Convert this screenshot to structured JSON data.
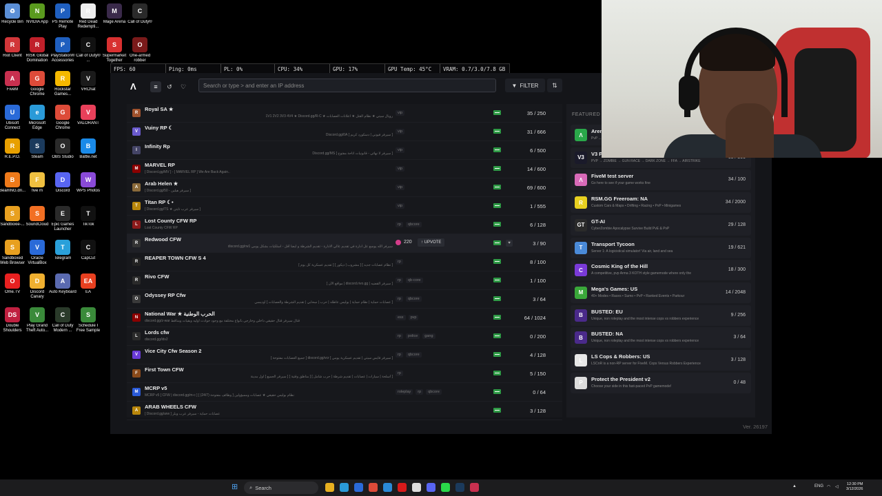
{
  "desktop_icons": [
    {
      "label": "Recycle Bin",
      "color": "#5b8fd6",
      "glyph": "♻"
    },
    {
      "label": "NVIDIA App",
      "color": "#5a9a1e",
      "glyph": "N"
    },
    {
      "label": "PS Remote Play",
      "color": "#1f5fbf",
      "glyph": "P"
    },
    {
      "label": "Red Dead Redempti...",
      "color": "#eeeeee",
      "glyph": "R"
    },
    {
      "label": "Mage Arena",
      "color": "#3a2a4a",
      "glyph": "M"
    },
    {
      "label": "Call of Duty®",
      "color": "#2a2a2a",
      "glyph": "C"
    },
    {
      "label": "Riot Client",
      "color": "#d13639",
      "glyph": "R"
    },
    {
      "label": "RISK Global Domination",
      "color": "#c0202a",
      "glyph": "R"
    },
    {
      "label": "PlayStation® Accessories",
      "color": "#1f5fbf",
      "glyph": "P"
    },
    {
      "label": "Call of Duty® ...",
      "color": "#111111",
      "glyph": "C"
    },
    {
      "label": "Supermarket Together",
      "color": "#d83030",
      "glyph": "S"
    },
    {
      "label": "One-armed robber",
      "color": "#7a1a1a",
      "glyph": "O"
    },
    {
      "label": "FiveM",
      "color": "#c8304f",
      "glyph": "A"
    },
    {
      "label": "Google Chrome",
      "color": "#dd4b39",
      "glyph": "G"
    },
    {
      "label": "Rockstar Games...",
      "color": "#f5b800",
      "glyph": "R"
    },
    {
      "label": "VRChat",
      "color": "#1a1a1a",
      "glyph": "V"
    },
    {
      "label": "Ubisoft Connect",
      "color": "#2a6ad8",
      "glyph": "U"
    },
    {
      "label": "Microsoft Edge",
      "color": "#2a9ad8",
      "glyph": "e"
    },
    {
      "label": "Google Chrome",
      "color": "#dd4b39",
      "glyph": "G"
    },
    {
      "label": "VALORANT",
      "color": "#e8405a",
      "glyph": "V"
    },
    {
      "label": "R.E.P.O.",
      "color": "#e8a000",
      "glyph": "R"
    },
    {
      "label": "Steam",
      "color": "#1b3a5c",
      "glyph": "S"
    },
    {
      "label": "OBS Studio",
      "color": "#2a2a2a",
      "glyph": "O"
    },
    {
      "label": "Battle.net",
      "color": "#1a8ae8",
      "glyph": "B"
    },
    {
      "label": "BeamNG.dri...",
      "color": "#ef7a1a",
      "glyph": "B"
    },
    {
      "label": "five m",
      "color": "#f0c040",
      "glyph": "F"
    },
    {
      "label": "Discord",
      "color": "#5865f2",
      "glyph": "D"
    },
    {
      "label": "WPS Photos",
      "color": "#8a4ad8",
      "glyph": "W"
    },
    {
      "label": "Sandboxie-...",
      "color": "#e8a020",
      "glyph": "S"
    },
    {
      "label": "SoundCloud",
      "color": "#f26f23",
      "glyph": "S"
    },
    {
      "label": "Epic Games Launcher",
      "color": "#2a2a2a",
      "glyph": "E"
    },
    {
      "label": "TikTok",
      "color": "#111111",
      "glyph": "T"
    },
    {
      "label": "Sandboxed Web Browser",
      "color": "#e8a020",
      "glyph": "S"
    },
    {
      "label": "Oracle VirtualBox",
      "color": "#2a6ad8",
      "glyph": "V"
    },
    {
      "label": "Telegram",
      "color": "#2aa0da",
      "glyph": "T"
    },
    {
      "label": "CapCut",
      "color": "#111111",
      "glyph": "C"
    },
    {
      "label": "Ome.TV",
      "color": "#e82020",
      "glyph": "O"
    },
    {
      "label": "Discord Canary",
      "color": "#f0b030",
      "glyph": "D"
    },
    {
      "label": "Auto Keyboard",
      "color": "#5a6ab0",
      "glyph": "A"
    },
    {
      "label": "EA",
      "color": "#e84020",
      "glyph": "EA"
    },
    {
      "label": "Double Shoulders",
      "color": "#c02040",
      "glyph": "DS"
    },
    {
      "label": "Play Grand Theft Auto...",
      "color": "#3a8a3a",
      "glyph": "V"
    },
    {
      "label": "Call of Duty Modern ...",
      "color": "#2a3a2a",
      "glyph": "C"
    },
    {
      "label": "Schedule I Free Sample",
      "color": "#3a8a3a",
      "glyph": "S"
    }
  ],
  "stats": {
    "fps": "FPS: 60",
    "ping": "Ping: 0ms",
    "pl": "PL: 0%",
    "cpu": "CPU: 34%",
    "gpu": "GPU: 17%",
    "gpu_temp": "GPU Temp: 45°C",
    "vram": "VRAM: 0.7/3.0/7.8 GB"
  },
  "app": {
    "logo": "Λ",
    "search_placeholder": "Search or type > and enter an IP address",
    "filter_label": "FILTER",
    "featured_label": "FEATURED S",
    "version": "Ver. 26197"
  },
  "servers": [
    {
      "name": "Royal SA ★",
      "desc": "رويال سيتي ★ نظام القتل ★ اعلانات العصابات ★ 1V1 2V2 3V3 4V4 ★ Discord.gg/R-C",
      "tags": [
        "vip"
      ],
      "players": "35 / 250",
      "color": "#a0522d",
      "glyph": "R"
    },
    {
      "name": "Vuiny RP ☾",
      "desc": "[ سيرفر فيوني | دسكورد كريم ] Discord.gg/0A",
      "tags": [
        "vip"
      ],
      "players": "31 / 666",
      "color": "#6a5acd",
      "glyph": "V"
    },
    {
      "name": "Infinity Rp",
      "desc": "[ سيرفر لا نهائي - قانونيات اتاحة مفتوح ] Discord.gg/MS",
      "tags": [
        "vip"
      ],
      "players": "6 / 500",
      "color": "#444466",
      "glyph": "I"
    },
    {
      "name": "MARVEL RP",
      "desc": "[ Discord.gg/MV ] - [ MARVEL RP ] We Are Back Again..",
      "tags": [
        "vip"
      ],
      "players": "14 / 600",
      "color": "#8b0000",
      "glyph": "M"
    },
    {
      "name": "Arab Helen ★",
      "desc": "[ Discord.gg/50 - سيرفر هيلين ]",
      "tags": [
        "vip"
      ],
      "players": "69 / 600",
      "color": "#8a6a3a",
      "glyph": "A"
    },
    {
      "name": "Titan RP ☾•",
      "desc": "[ Discord.gg/TS ★ سيرفر عرب تايتن ]",
      "tags": [
        "vip"
      ],
      "players": "1 / 555",
      "color": "#b8860b",
      "glyph": "T"
    },
    {
      "name": "Lost County CFW RP",
      "desc": "Lost County CFW RP",
      "tags": [
        "rp",
        "qbcore"
      ],
      "players": "6 / 128",
      "color": "#8b1a1a",
      "glyph": "L"
    },
    {
      "name": "Redwood CFW",
      "desc": "سيرفر الله يوسع عل ادارة في تقديم عالي الادارة - تقديم الشرطة و ايضا أقل - اسلكيات بشكل يومي discord.gg/rw1",
      "tags": [],
      "players": "3 / 90",
      "color": "#333333",
      "glyph": "R",
      "upvotes": "220",
      "upvote_label": "UPVOTE"
    },
    {
      "name": "REAPER TOWN CFW S 4",
      "desc": "[ نظام عصابات جديد ] [ مشروب | ديكور ] [ تقديم عسكرية كل يوم ]",
      "tags": [
        "rp"
      ],
      "players": "8 / 100",
      "color": "#222222",
      "glyph": "R"
    },
    {
      "name": "Rivo CFW",
      "desc": "[ سيرفر القضيه | discord.rivo.gg | مواقع الآن ]",
      "tags": [
        "rp",
        "qb-core"
      ],
      "players": "1 / 100",
      "color": "#2a2a2a",
      "glyph": "R"
    },
    {
      "name": "Odyssey RP Cfw",
      "desc": "[ عصابات حماية | نظام حماية | بوليس عاطله | حرب | سحابي | تقديم الشرطة والعصابات ] أوديسي",
      "tags": [
        "rp",
        "qbcore"
      ],
      "players": "3 / 64",
      "color": "#3a3a3a",
      "glyph": "O"
    },
    {
      "name": "National War ★ الحرب الوطنية",
      "desc": "discord.gg/z-war قتال سيرفر قتال حقيقي داخلي وخارجي بأنواع مختلفة مع وجود حوادث اوليه وبقيات ومناقط",
      "tags": [
        "esx",
        "pvp"
      ],
      "players": "64 / 1024",
      "color": "#8b0000",
      "glyph": "N"
    },
    {
      "name": "Lords cfw",
      "desc": "discord.gg/ldv2",
      "tags": [
        "rp",
        "police",
        "gang"
      ],
      "players": "0 / 200",
      "color": "#2a2a2a",
      "glyph": "L"
    },
    {
      "name": "Vice City Cfw Season 2",
      "desc": "[ سيرفر فايس سيتي | تقديم عسكرية يومي ] discord.gg/vcr [ جميع العصابات مفتوحة ]",
      "tags": [
        "rp",
        "qbcore"
      ],
      "players": "4 / 128",
      "color": "#6a3ad8",
      "glyph": "V"
    },
    {
      "name": "First Town CFW",
      "desc": "[ أسلحة | سيارات | عصابات | تقديم شرطة | حرب شامل ] [ مناطق وقتية ] [ سيرفر الجميع ] اول مدينة",
      "tags": [
        "rp"
      ],
      "players": "5 / 150",
      "color": "#8a4a1a",
      "glyph": "F"
    },
    {
      "name": "MCRP v5",
      "desc": "MCRP v5 [ CFW | discord.gg/m-c ] [ وظائف مفتوحة (24/7) ] نظام بوليس حقيقي ★ عصابات ومسؤولين",
      "tags": [
        "roleplay",
        "rp",
        "qbcore"
      ],
      "players": "0 / 64",
      "color": "#2a5ad8",
      "glyph": "M"
    },
    {
      "name": "ARAB WHEELS CFW",
      "desc": "[ Discord.gg/arw ] عصابات حماية - سيرفر عرب ويلز",
      "tags": [],
      "players": "3 / 128",
      "color": "#b8860b",
      "glyph": "A"
    }
  ],
  "featured": [
    {
      "name": "Arena",
      "desc": "PvP ...",
      "players": "",
      "color": "#2aa84a",
      "glyph": "Λ"
    },
    {
      "name": "V3 P...",
      "desc": "PVP → ZOMBIE → GUN RACE → DARK ZONE → FFA → AIRSTRIKE",
      "players": "68 / 300",
      "color": "#1a1a2a",
      "glyph": "V3"
    },
    {
      "name": "FiveM test server",
      "desc": "Go here to see if your game works fine",
      "players": "34 / 100",
      "color": "#d86ab8",
      "glyph": "Λ"
    },
    {
      "name": "RSM.GG Freeroam: NA",
      "desc": "Custom Cars & Maps • Drifting • Racing • PvP • Minigames",
      "players": "34 / 2000",
      "color": "#e8d020",
      "glyph": "R"
    },
    {
      "name": "GT-AI",
      "desc": "CyberZombie Apocalypse Survive Build PvE & PvP",
      "players": "29 / 128",
      "color": "#2a2a2a",
      "glyph": "GT"
    },
    {
      "name": "Transport Tycoon",
      "desc": "Server 1: A logicistical simulator! Via air, land and sea",
      "players": "19 / 621",
      "color": "#4a8ad8",
      "glyph": "T"
    },
    {
      "name": "Cosmic King of the Hill",
      "desc": "A competitive, pvp Arma 3 KOTH style gamemode where only the",
      "players": "18 / 300",
      "color": "#7a3ad8",
      "glyph": "C"
    },
    {
      "name": "Mega's Games: US",
      "desc": "40+ Modes • Races • Sumo • PvP • Ranked Events • Parkour",
      "players": "14 / 2048",
      "color": "#3aa83a",
      "glyph": "M"
    },
    {
      "name": "BUSTED: EU",
      "desc": "Unique, non roleplay and the most intense cops vs robbers experience",
      "players": "9 / 256",
      "color": "#4a2a8a",
      "glyph": "B"
    },
    {
      "name": "BUSTED: NA",
      "desc": "Unique, non roleplay and the most intense cops vs robbers experience",
      "players": "3 / 64",
      "color": "#4a2a8a",
      "glyph": "B"
    },
    {
      "name": "LS Cops & Robbers: US",
      "desc": "LSCnR is a non-RP server for FiveM. Cops Versus Robbers Experience",
      "players": "3 / 128",
      "color": "#e8e8e8",
      "glyph": "L"
    },
    {
      "name": "Protect the President v2",
      "desc": "Choose your side in this fast-paced PvP gamemode!",
      "players": "0 / 48",
      "color": "#dddddd",
      "glyph": "P"
    }
  ],
  "taskbar": {
    "search_label": "Search",
    "lang": "ENG",
    "time": "12:30 PM",
    "date": "3/12/2026",
    "apps": [
      {
        "name": "file-explorer-icon",
        "color": "#e8b020"
      },
      {
        "name": "edge-icon",
        "color": "#2a9ad8"
      },
      {
        "name": "store-icon",
        "color": "#2a6ad8"
      },
      {
        "name": "chrome-icon",
        "color": "#dd4b39"
      },
      {
        "name": "vscode-icon",
        "color": "#2a8ad8"
      },
      {
        "name": "netflix-icon",
        "color": "#d81a1a"
      },
      {
        "name": "notion-icon",
        "color": "#dddddd"
      },
      {
        "name": "discord-icon",
        "color": "#5865f2"
      },
      {
        "name": "whatsapp-icon",
        "color": "#2ad84a"
      },
      {
        "name": "steam-icon",
        "color": "#1b3a5c"
      },
      {
        "name": "fivem-icon",
        "color": "#c8304f"
      }
    ]
  }
}
